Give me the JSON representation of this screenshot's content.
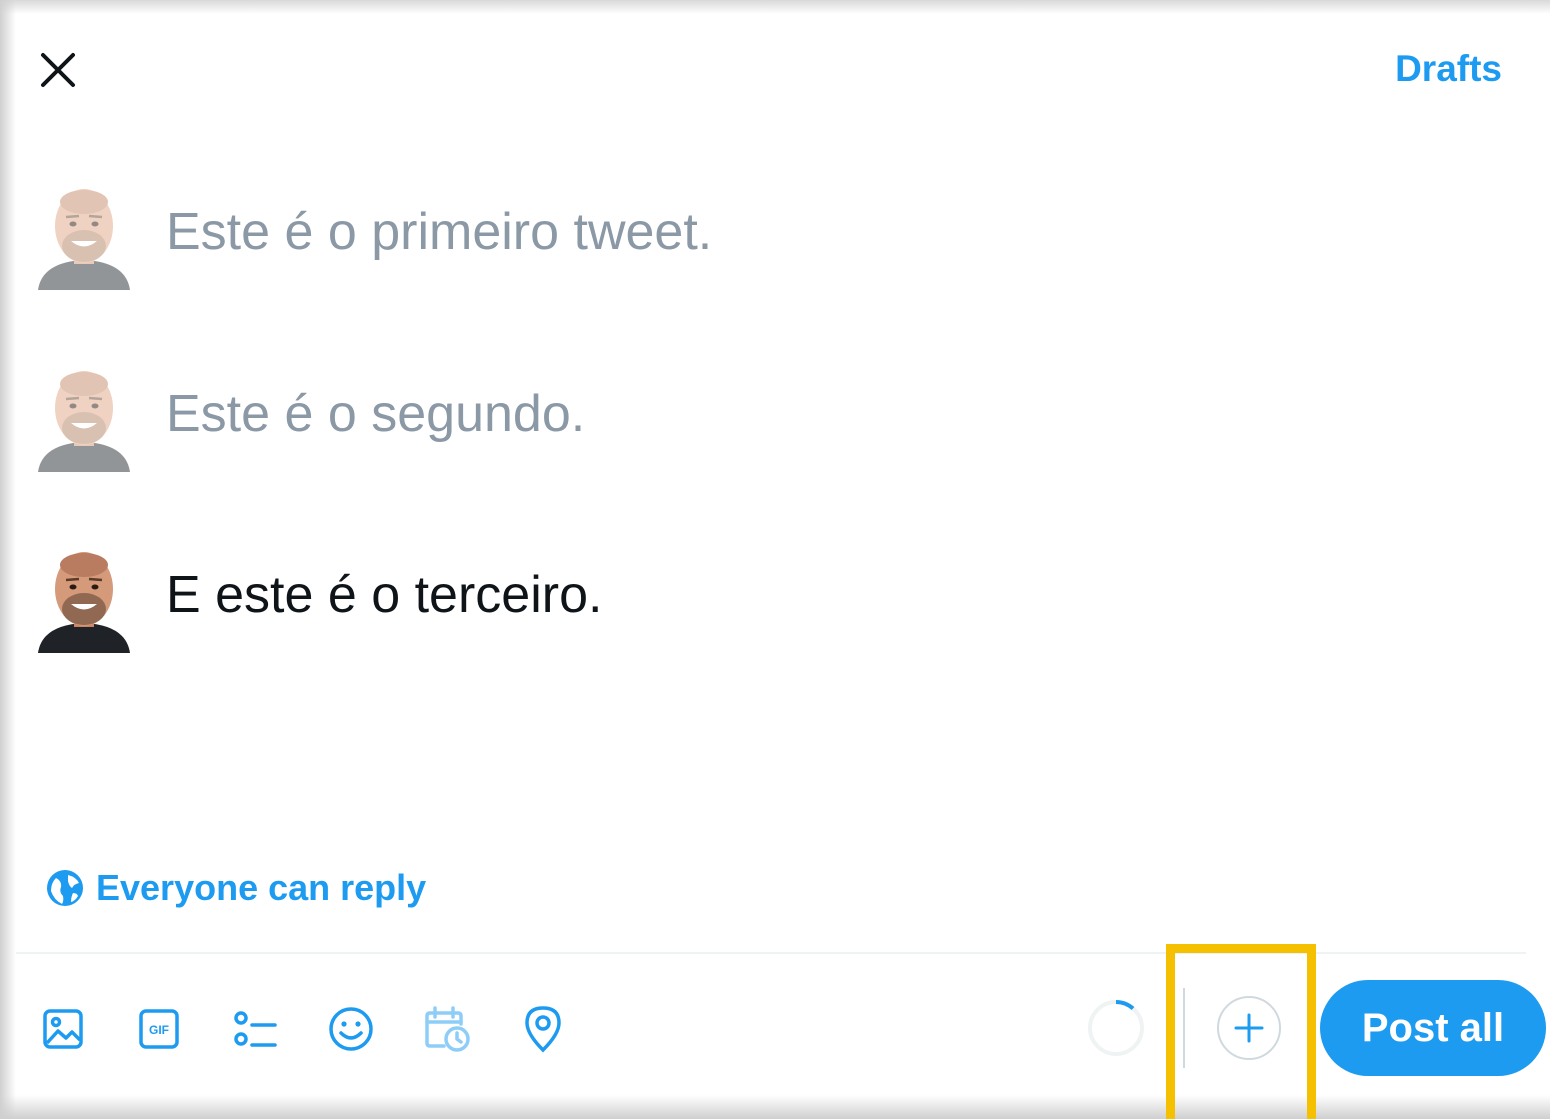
{
  "header": {
    "close_icon": "close-icon",
    "drafts_label": "Drafts"
  },
  "thread": [
    {
      "text": "Este é o primeiro tweet.",
      "active": false
    },
    {
      "text": "Este é o segundo.",
      "active": false
    },
    {
      "text": "E este é o terceiro.",
      "active": true
    }
  ],
  "reply_setting": {
    "icon": "globe-icon",
    "label": "Everyone can reply"
  },
  "toolbar": {
    "tools": [
      "image-icon",
      "gif-icon",
      "poll-icon",
      "emoji-icon",
      "schedule-icon",
      "location-icon"
    ],
    "add_tweet_icon": "plus-icon",
    "post_label": "Post all"
  },
  "colors": {
    "accent": "#1d9bf0",
    "text": "#0f1419",
    "placeholder_text": "#8b98a5",
    "highlight": "#f5c000"
  }
}
